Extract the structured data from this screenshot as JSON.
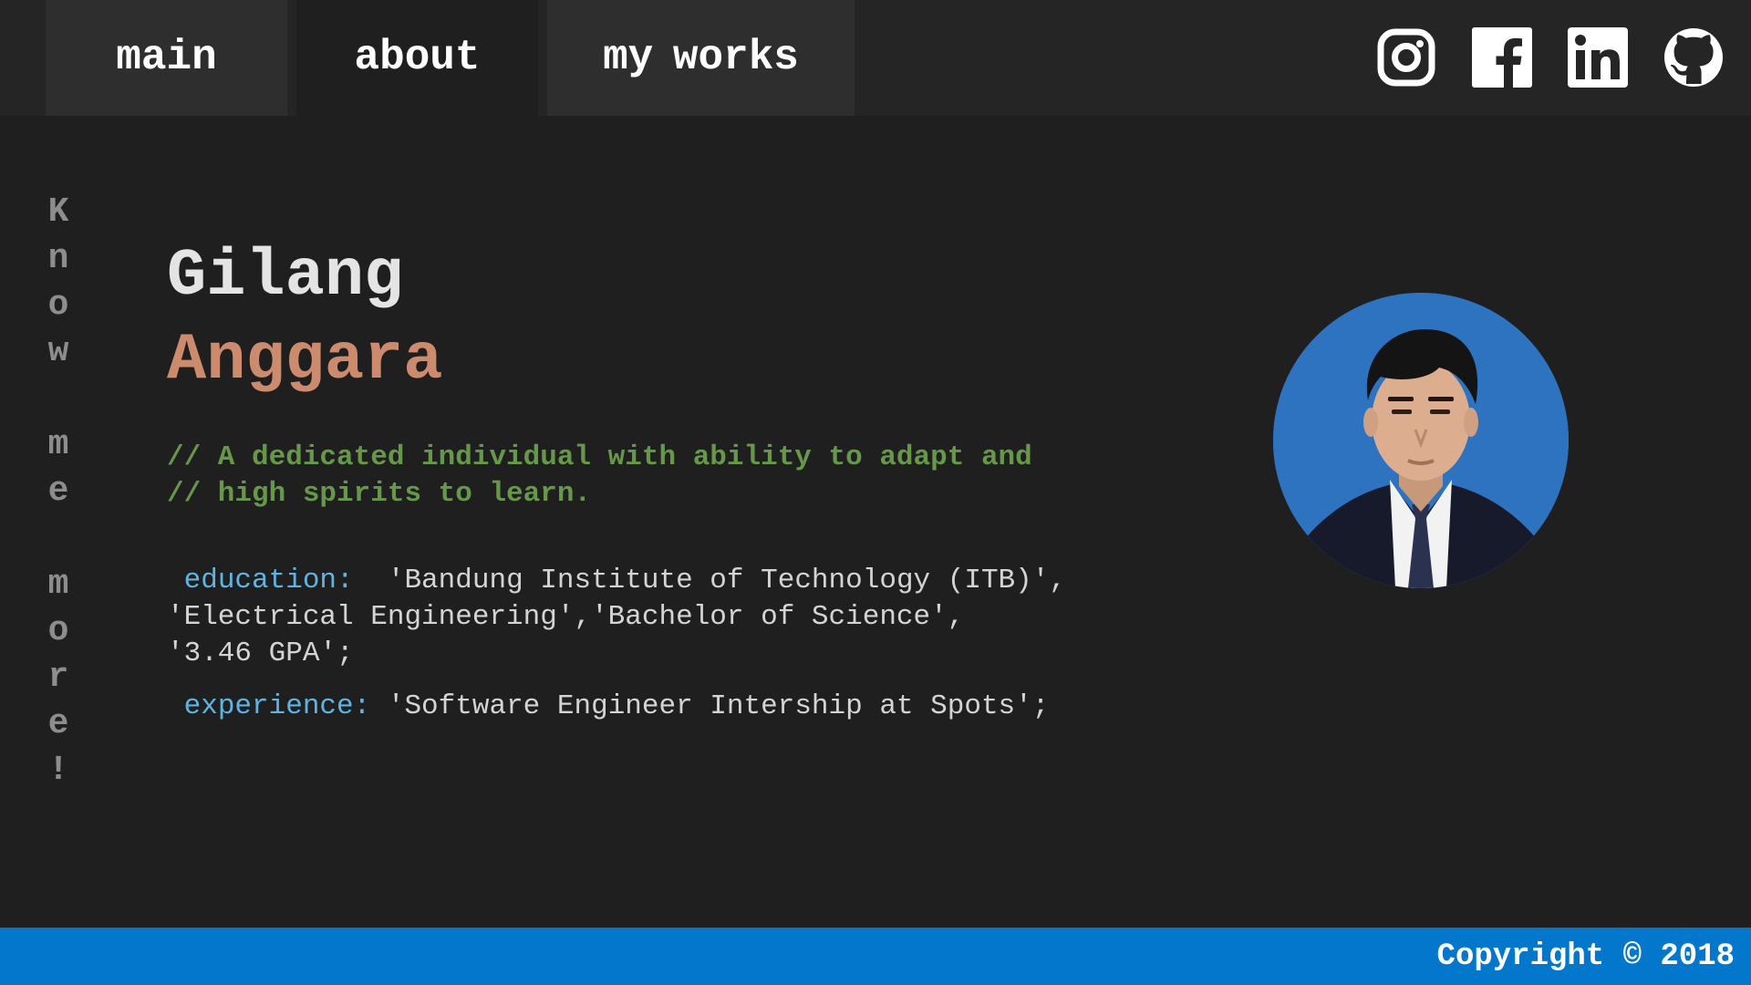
{
  "nav": {
    "tabs": [
      {
        "label": "main"
      },
      {
        "label": "about"
      },
      {
        "label": "my works"
      }
    ],
    "social": [
      "instagram-icon",
      "facebook-icon",
      "linkedin-icon",
      "github-icon"
    ]
  },
  "side_text": [
    "K",
    "n",
    "o",
    "w",
    " ",
    "m",
    "e",
    " ",
    "m",
    "o",
    "r",
    "e",
    "!"
  ],
  "profile": {
    "first_name": "Gilang",
    "last_name": "Anggara",
    "comment_line1": "// A dedicated individual with ability to adapt and",
    "comment_line2": "// high spirits to learn.",
    "education_key": "education:",
    "education_line1": "  'Bandung Institute of Technology (ITB)',",
    "education_line2": "'Electrical Engineering','Bachelor of Science',",
    "education_line3": "'3.46 GPA';",
    "experience_key": "experience:",
    "experience_value": " 'Software Engineer Intership at Spots';"
  },
  "footer": {
    "copyright": "Copyright © 2018"
  },
  "colors": {
    "background": "#1f1f1f",
    "navbar": "#252525",
    "name_accent": "#cd8b6e",
    "comment": "#66984a",
    "key": "#5fb4e3",
    "footer": "#0277cc"
  }
}
